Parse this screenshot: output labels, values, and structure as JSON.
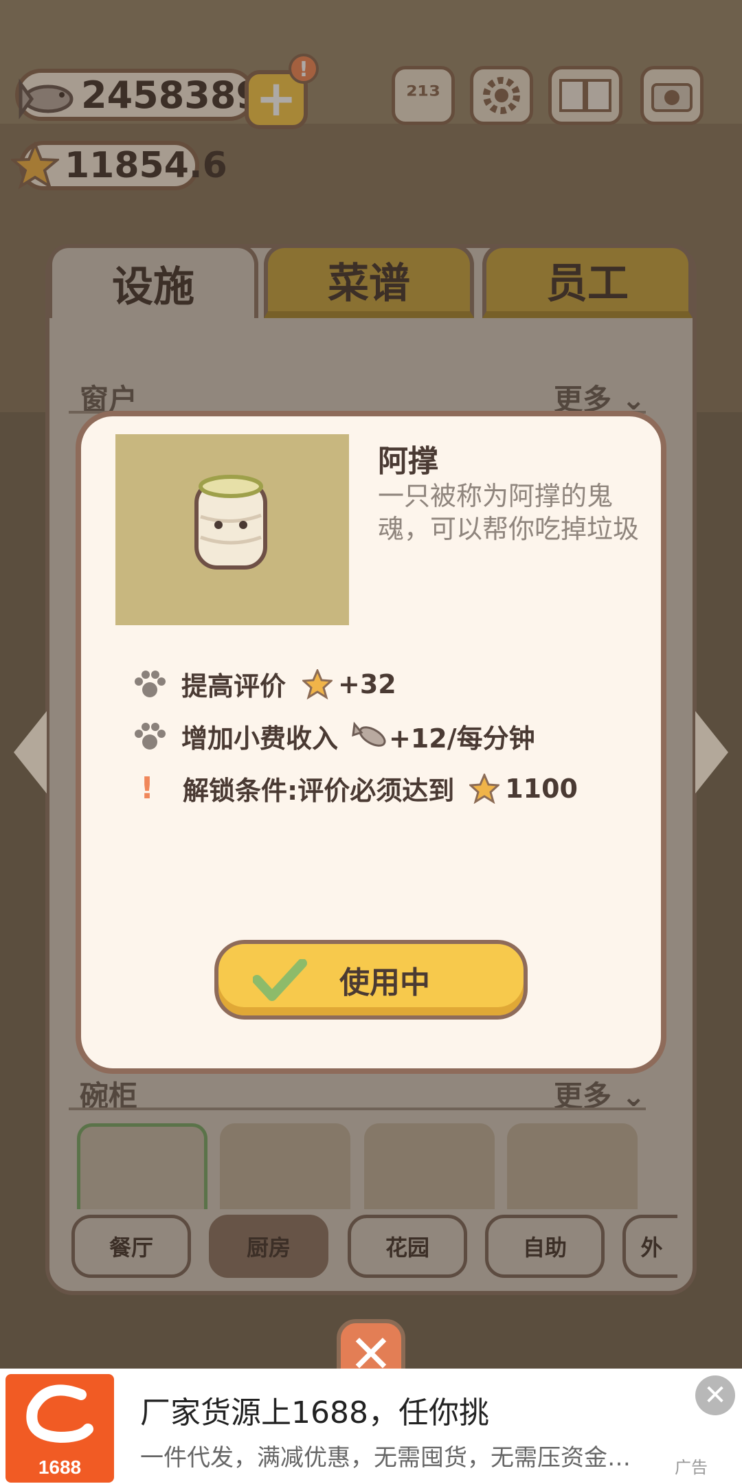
{
  "hud": {
    "fish_count": "2458389",
    "star_rating": "11854.6",
    "plus_label": "+",
    "alert_mark": "!"
  },
  "tabs": [
    {
      "label": "设施",
      "active": true
    },
    {
      "label": "菜谱",
      "active": false
    },
    {
      "label": "员工",
      "active": false
    }
  ],
  "sections": {
    "window": {
      "label": "窗户",
      "more": "更多"
    },
    "cupboard": {
      "label": "碗柜",
      "more": "更多"
    }
  },
  "categories": [
    {
      "label": "餐厅",
      "active": false
    },
    {
      "label": "厨房",
      "active": true
    },
    {
      "label": "花园",
      "active": false
    },
    {
      "label": "自助",
      "active": false
    },
    {
      "label": "外",
      "active": false
    }
  ],
  "popup": {
    "title": "阿撑",
    "description": "一只被称为阿撑的鬼魂，可以帮你吃掉垃圾",
    "stats": [
      {
        "icon": "paw-icon",
        "label": "提高评价",
        "value_icon": "star-icon",
        "value": "+32"
      },
      {
        "icon": "paw-icon",
        "label": "增加小费收入",
        "value_icon": "fish-icon",
        "value": "+12/每分钟"
      },
      {
        "icon": "exclamation-icon",
        "label": "解锁条件:评价必须达到",
        "value_icon": "star-icon",
        "value": "1100"
      }
    ],
    "button_label": "使用中",
    "button_icon": "checkmark-icon"
  },
  "close_label": "✕",
  "ad": {
    "title": "厂家货源上1688，任你挑",
    "subtitle": "一件代发，满减优惠，无需囤货，无需压资金…",
    "logo_text": "1688",
    "tag": "广告",
    "close_label": "✕"
  },
  "colors": {
    "accent_yellow": "#f7c94c",
    "panel_border": "#8e7767",
    "popup_bg": "#fdf5ec",
    "alert": "#f08a5a",
    "ad_brand": "#f15b24"
  }
}
